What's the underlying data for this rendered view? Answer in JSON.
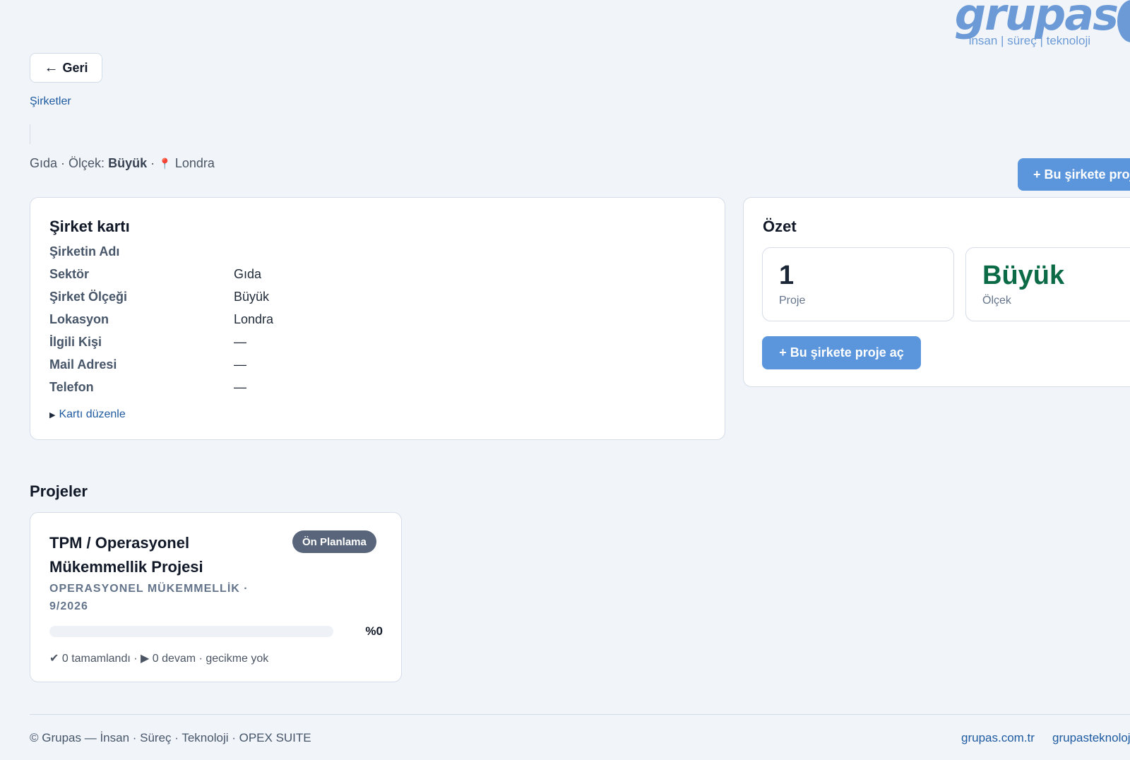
{
  "brand": {
    "logo_word": "grupas",
    "logo_tagline": "insan | süreç | teknoloji",
    "color": "#6b9ad6"
  },
  "nav": {
    "back_arrow": "←",
    "back_label": "Geri",
    "breadcrumb": "Şirketler"
  },
  "company": {
    "meta_sector": "Gıda",
    "meta_scale_prefix": "Ölçek:",
    "meta_scale": "Büyük",
    "meta_pin": "📍",
    "meta_location": "Londra",
    "top_action_label": "+ Bu şirkete proje aç"
  },
  "company_card": {
    "title": "Şirket kartı",
    "fields": [
      {
        "label": "Şirketin Adı",
        "value": ""
      },
      {
        "label": "Sektör",
        "value": "Gıda"
      },
      {
        "label": "Şirket Ölçeği",
        "value": "Büyük"
      },
      {
        "label": "Lokasyon",
        "value": "Londra"
      },
      {
        "label": "İlgili Kişi",
        "value": "—"
      },
      {
        "label": "Mail Adresi",
        "value": "—"
      },
      {
        "label": "Telefon",
        "value": "—"
      }
    ],
    "edit_label": "Kartı düzenle"
  },
  "summary": {
    "title": "Özet",
    "stats": [
      {
        "value": "1",
        "label": "Proje"
      },
      {
        "value": "Büyük",
        "label": "Ölçek"
      }
    ],
    "action_label": "+ Bu şirkete proje aç"
  },
  "projects": {
    "title": "Projeler",
    "items": [
      {
        "name": "TPM / Operasyonel Mükemmellik Projesi",
        "status": "Ön Planlama",
        "subtitle": "OPERASYONEL MÜKEMMELLİK · 9/2026",
        "progress": 0,
        "progress_label": "%0",
        "footer": "✔ 0 tamamlandı · ▶ 0 devam · gecikme yok"
      }
    ]
  },
  "footer": {
    "copyright": "© Grupas — İnsan · Süreç · Teknoloji · OPEX SUITE",
    "links": [
      "grupas.com.tr",
      "grupasteknoloji"
    ]
  },
  "colors": {
    "accent": "#5b96dd",
    "link": "#1e5aa0",
    "badge": "#58657a",
    "scale_green": "#0c6b47"
  }
}
